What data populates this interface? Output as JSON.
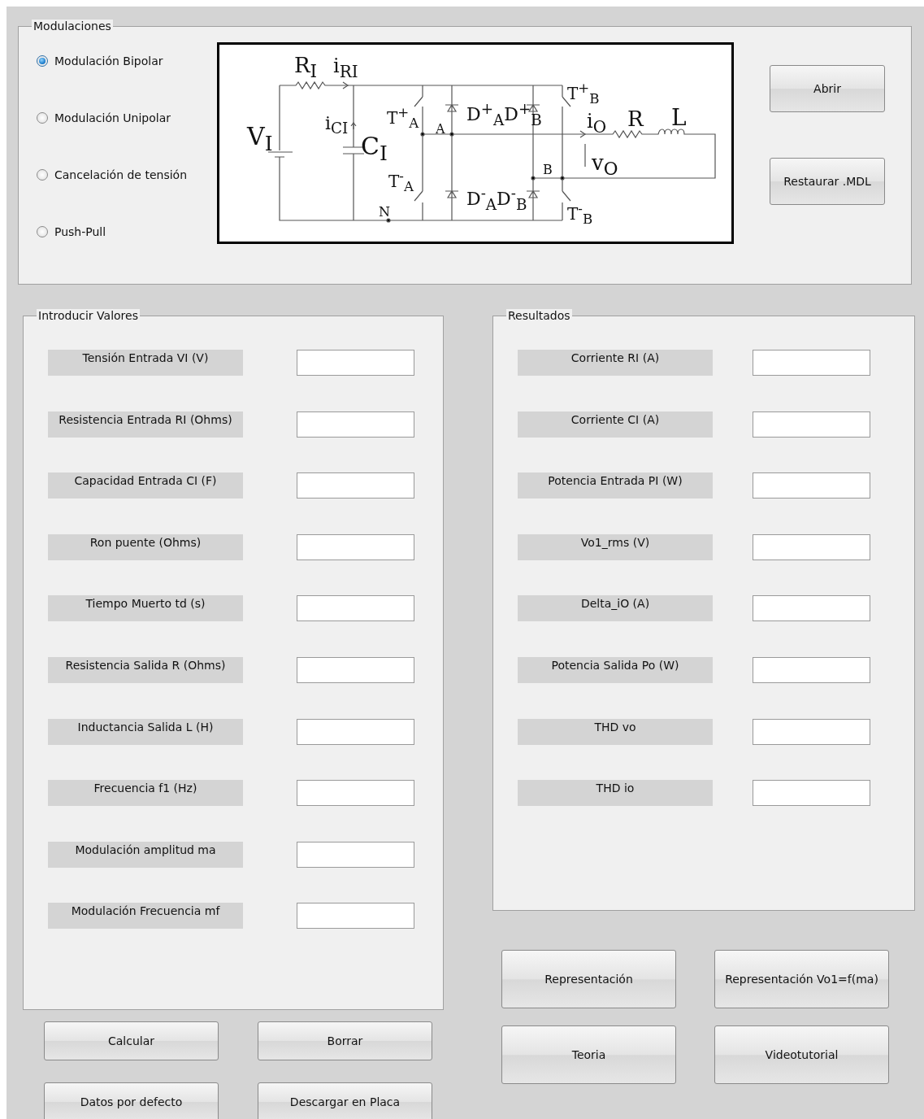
{
  "modulaciones": {
    "title": "Modulaciones",
    "options": [
      {
        "label": "Modulación Bipolar",
        "selected": true
      },
      {
        "label": "Modulación Unipolar",
        "selected": false
      },
      {
        "label": "Cancelación de tensión",
        "selected": false
      },
      {
        "label": "Push-Pull",
        "selected": false
      }
    ]
  },
  "circuit": {
    "labels": [
      "R$_{I}$",
      "i$_{RI}$",
      "V$_{I}$",
      "i$_{CI}$",
      "C$_{I}$",
      "T$^{+}$$_{A}$",
      "A",
      "D$^{+}$$_{A}$D$^{+}$$_{B}$",
      "T$^{+}$$_{B}$",
      "i$_{O}$",
      "R",
      "L",
      "v$_{O}$",
      "B",
      "T$^{-}$$_{A}$",
      "D$^{-}$$_{A}$D$^{-}$$_{B}$",
      "T$^{-}$$_{B}$",
      "N"
    ]
  },
  "side_buttons": [
    "Abrir",
    "Restaurar .MDL"
  ],
  "inputs": {
    "title": "Introducir Valores",
    "rows": [
      "Tensión Entrada VI (V)",
      "Resistencia Entrada RI (Ohms)",
      "Capacidad Entrada CI (F)",
      "Ron puente (Ohms)",
      "Tiempo Muerto td (s)",
      "Resistencia Salida R (Ohms)",
      "Inductancia Salida L (H)",
      "Frecuencia f1 (Hz)",
      "Modulación amplitud ma",
      "Modulación Frecuencia mf"
    ]
  },
  "results": {
    "title": "Resultados",
    "rows": [
      "Corriente RI (A)",
      "Corriente CI (A)",
      "Potencia Entrada PI (W)",
      "Vo1_rms (V)",
      "Delta_iO (A)",
      "Potencia Salida Po (W)",
      "THD vo",
      "THD io"
    ]
  },
  "left_buttons": [
    "Calcular",
    "Borrar",
    "Datos por defecto",
    "Descargar en Placa"
  ],
  "right_buttons": [
    "Representación",
    "Representación Vo1=f(ma)",
    "Teoria",
    "Videotutorial"
  ]
}
